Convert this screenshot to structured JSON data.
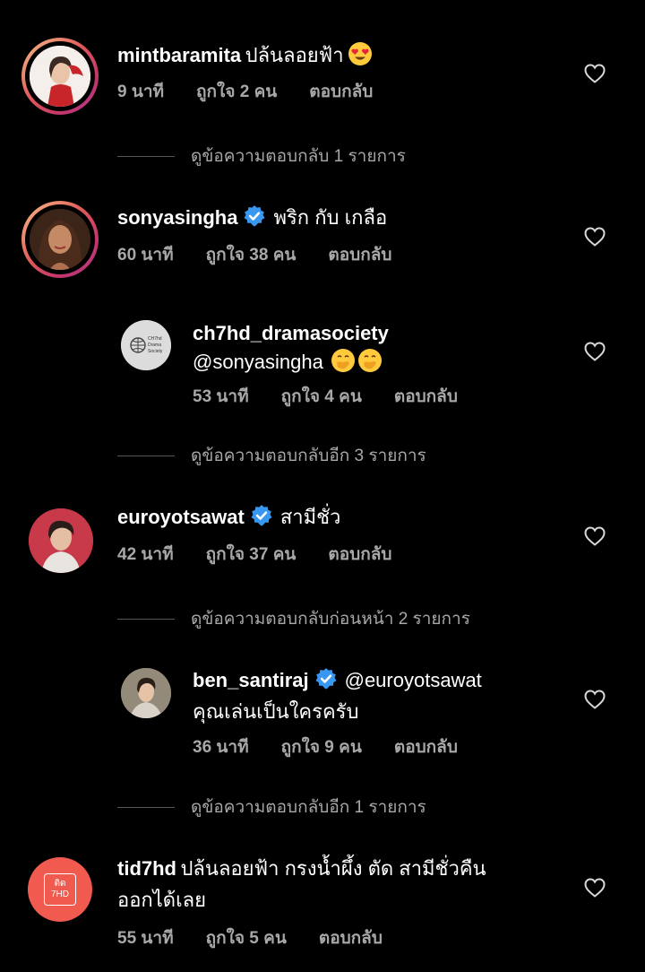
{
  "colors": {
    "background": "#000000",
    "text_primary": "#ffffff",
    "text_secondary": "#a8a8a8",
    "verified": "#3897f0",
    "tid7hd_avatar": "#f05a4f"
  },
  "comments": [
    {
      "username": "mintbaramita",
      "verified": false,
      "text": "ปล้นลอยฟ้า",
      "emoji": "heart-eyes",
      "time": "9 นาที",
      "likes": "ถูกใจ 2 คน",
      "reply": "ตอบกลับ"
    },
    {
      "username": "sonyasingha",
      "verified": true,
      "text": "พริก กับ เกลือ",
      "time": "60 นาที",
      "likes": "ถูกใจ 38 คน",
      "reply": "ตอบกลับ"
    },
    {
      "username": "ch7hd_dramasociety",
      "verified": false,
      "text": "@sonyasingha",
      "emoji": "hand-over-mouth x2",
      "time": "53 นาที",
      "likes": "ถูกใจ 4 คน",
      "reply": "ตอบกลับ",
      "avatar_text": "CH7hd Drama Society"
    },
    {
      "username": "euroyotsawat",
      "verified": true,
      "text": "สามีชั่ว",
      "time": "42 นาที",
      "likes": "ถูกใจ 37 คน",
      "reply": "ตอบกลับ"
    },
    {
      "username": "ben_santiraj",
      "verified": true,
      "text": "@euroyotsawat",
      "text2": "คุณเล่นเป็นใครครับ",
      "time": "36 นาที",
      "likes": "ถูกใจ 9 คน",
      "reply": "ตอบกลับ"
    },
    {
      "username": "tid7hd",
      "verified": false,
      "text": "ปล้นลอยฟ้า กรงน้ำผึ้ง ตัด สามีชั่วคืน",
      "text2": "ออกได้เลย",
      "time": "55 นาที",
      "likes": "ถูกใจ 5 คน",
      "reply": "ตอบกลับ",
      "avatar_text1": "ติด",
      "avatar_text2": "7HD"
    }
  ],
  "view_more": {
    "mint": "ดูข้อความตอบกลับ 1 รายการ",
    "sonya": "ดูข้อความตอบกลับอีก 3 รายการ",
    "euro": "ดูข้อความตอบกลับก่อนหน้า 2 รายการ",
    "ben": "ดูข้อความตอบกลับอีก 1 รายการ"
  }
}
